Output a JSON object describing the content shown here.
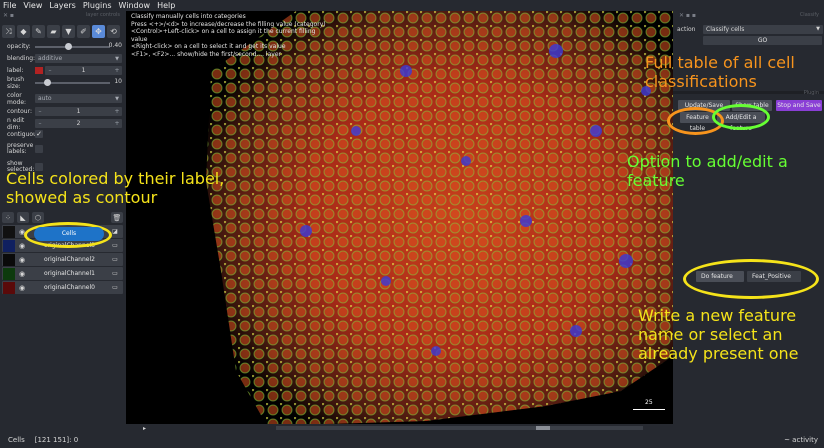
{
  "menu": [
    "File",
    "View",
    "Layers",
    "Plugins",
    "Window",
    "Help"
  ],
  "left_panel": {
    "header_label": "layer controls",
    "properties": {
      "opacity": {
        "label": "opacity:",
        "value": "0.40",
        "fraction": 0.4
      },
      "blending": {
        "label": "blending:",
        "value": "additive"
      },
      "label": {
        "label": "label:",
        "value": "1"
      },
      "brush_size": {
        "label": "brush size:",
        "value": "10",
        "fraction": 0.12
      },
      "color_mode": {
        "label": "color mode:",
        "value": "auto"
      },
      "contour": {
        "label": "contour:",
        "value": "1"
      },
      "n_edit_dim": {
        "label": "n edit dim:",
        "value": "2"
      },
      "contiguous": {
        "label": "contiguous:",
        "checked": true
      },
      "preserve_labels": {
        "label": "preserve labels:",
        "checked": false
      },
      "show_selected": {
        "label": "show selected:",
        "checked": false
      }
    },
    "layers": [
      {
        "name": "Cells",
        "selected": true
      },
      {
        "name": "originalChannel3",
        "selected": false
      },
      {
        "name": "originalChannel2",
        "selected": false
      },
      {
        "name": "originalChannel1",
        "selected": false
      },
      {
        "name": "originalChannel0",
        "selected": false
      }
    ]
  },
  "canvas": {
    "info_lines": [
      "Classify manually cells into categories",
      "Press <+>/<d> to increase/decrease the filling value (category)",
      "<Control>+Left-click> on a cell to assign it the current filling value",
      "<Right-click> on a cell to select it and get its value",
      "<F1>, <F2>... show/hide the first/second.... layer"
    ],
    "scalebar": "25"
  },
  "right_panel": {
    "dock_label": "Classify",
    "action_label": "action",
    "action_value": "Classify cells",
    "go_label": "GO",
    "section_label": "Plugin",
    "update_table_label": "Update/Save table",
    "show_table_label": "Show table",
    "stop_save_label": "Stop and Save",
    "feature_table_label": "Feature table",
    "add_edit_feature_label": "Add/Edit a feature",
    "do_feature_label": "Do feature",
    "feature_name_value": "Feat_Positive"
  },
  "annotations": {
    "full_table": "Full table of all cell classifications",
    "add_edit": "Option to add/edit a feature",
    "cells_colored": "Cells colored by their label, showed as contour",
    "write_feature": "Write a new feature name or select an already present one"
  },
  "status": {
    "left": "Cells",
    "coords": "[121 151]: 0",
    "right": "~ activity"
  },
  "colors": {
    "accent_orange": "#f7941d",
    "accent_green": "#66ff33",
    "accent_yellow": "#f5e31a",
    "purple_button": "#8a3fd6",
    "selected_layer": "#1e73c8"
  }
}
